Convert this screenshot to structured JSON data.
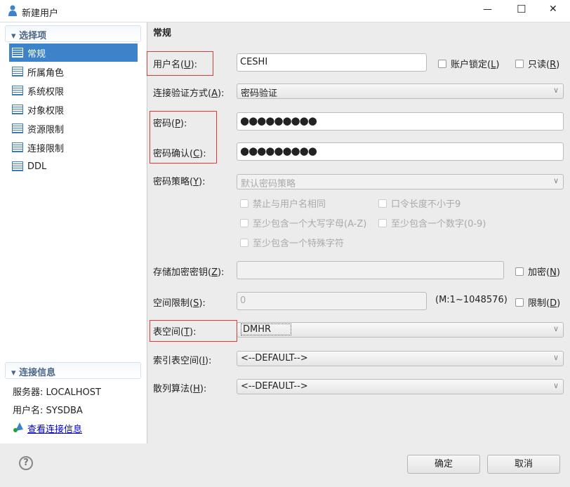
{
  "window": {
    "title": "新建用户",
    "minimize": "—",
    "maximize": "☐",
    "close": "✕"
  },
  "sidebar": {
    "section_title": "选择项",
    "items": [
      {
        "label": "常规"
      },
      {
        "label": "所属角色"
      },
      {
        "label": "系统权限"
      },
      {
        "label": "对象权限"
      },
      {
        "label": "资源限制"
      },
      {
        "label": "连接限制"
      },
      {
        "label": "DDL"
      }
    ]
  },
  "connection": {
    "section_title": "连接信息",
    "server": "服务器: LOCALHOST",
    "user": "用户名: SYSDBA",
    "link": "查看连接信息"
  },
  "form": {
    "section_title": "常规",
    "username": {
      "label": "用户名(",
      "key": "U",
      "end": "):",
      "value": "CESHI"
    },
    "account_lock": {
      "label": "账户锁定(",
      "key": "L",
      "end": ")"
    },
    "readonly": {
      "label": "只读(",
      "key": "R",
      "end": ")"
    },
    "auth": {
      "label": "连接验证方式(",
      "key": "A",
      "end": "):",
      "value": "密码验证"
    },
    "password": {
      "label": "密码(",
      "key": "P",
      "end": "):",
      "value": "●●●●●●●●●"
    },
    "password_confirm": {
      "label": "密码确认(",
      "key": "C",
      "end": "):",
      "value": "●●●●●●●●●"
    },
    "policy": {
      "label": "密码策略(",
      "key": "Y",
      "end": "):",
      "value": "默认密码策略",
      "options": [
        "禁止与用户名相同",
        "口令长度不小于9",
        "至少包含一个大写字母(A-Z)",
        "至少包含一个数字(0-9)",
        "至少包含一个特殊字符"
      ]
    },
    "encrypt_key": {
      "label": "存储加密密钥(",
      "key": "Z",
      "end": "):",
      "value": ""
    },
    "encrypt": {
      "label": "加密(",
      "key": "N",
      "end": ")"
    },
    "space_limit": {
      "label": "空间限制(",
      "key": "S",
      "end": "):",
      "value": "0",
      "range": "(M:1~1048576)"
    },
    "limit": {
      "label": "限制(",
      "key": "D",
      "end": ")"
    },
    "tablespace": {
      "label": "表空间(",
      "key": "T",
      "end": "):",
      "value": "DMHR"
    },
    "index_tablespace": {
      "label": "索引表空间(",
      "key": "I",
      "end": "):",
      "value": "<--DEFAULT-->"
    },
    "hash": {
      "label": "散列算法(",
      "key": "H",
      "end": "):",
      "value": "<--DEFAULT-->"
    }
  },
  "buttons": {
    "ok": "确定",
    "cancel": "取消",
    "help": "?"
  }
}
